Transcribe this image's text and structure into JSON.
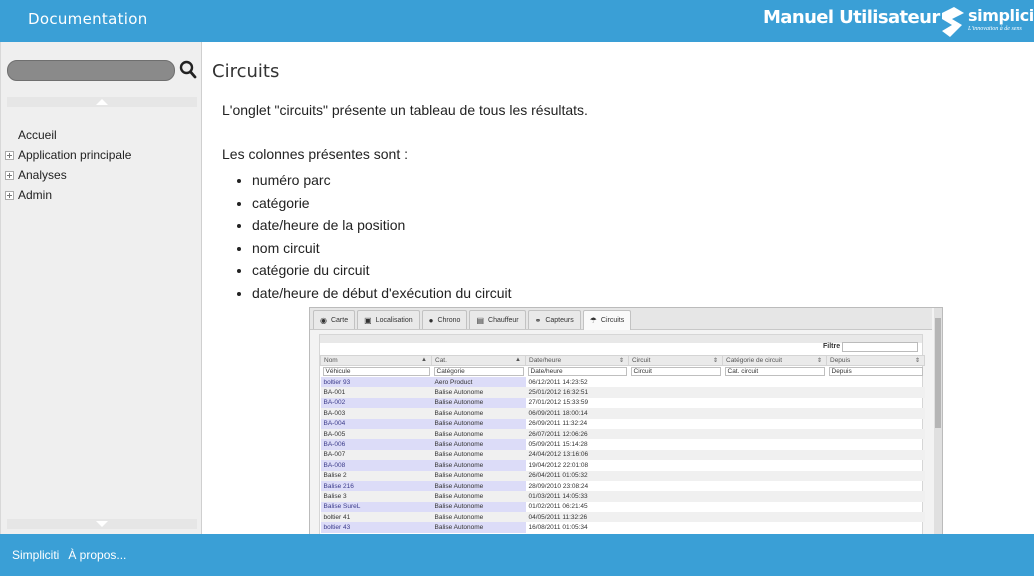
{
  "header": {
    "title": "Documentation",
    "manual_label": "Manuel Utilisateur",
    "brand_name": "simpliciti",
    "brand_tagline": "L'innovation à de sens"
  },
  "sidebar": {
    "search_placeholder": "",
    "items": [
      {
        "label": "Accueil",
        "expandable": false
      },
      {
        "label": "Application principale",
        "expandable": true
      },
      {
        "label": "Analyses",
        "expandable": true
      },
      {
        "label": "Admin",
        "expandable": true
      }
    ]
  },
  "main": {
    "title": "Circuits",
    "intro": "L'onglet \"circuits\" présente un tableau de tous les résultats.",
    "columns_intro": "Les colonnes présentes sont :",
    "bullets": [
      "numéro parc",
      "catégorie",
      "date/heure de la position",
      "nom circuit",
      "catégorie du circuit",
      "date/heure de début d'exécution du circuit"
    ]
  },
  "screenshot": {
    "tabs": [
      {
        "label": "Carte",
        "icon": "globe-icon"
      },
      {
        "label": "Localisation",
        "icon": "vehicle-icon"
      },
      {
        "label": "Chrono",
        "icon": "clock-icon"
      },
      {
        "label": "Chauffeur",
        "icon": "id-card-icon"
      },
      {
        "label": "Capteurs",
        "icon": "sensor-icon"
      },
      {
        "label": "Circuits",
        "icon": "route-icon",
        "active": true
      }
    ],
    "filter_label": "Filtre",
    "columns": [
      "Nom",
      "Cat.",
      "Date/heure",
      "Circuit",
      "Catégorie de circuit",
      "Depuis"
    ],
    "filters": [
      "Véhicule",
      "Catégorie",
      "Date/heure",
      "Circuit",
      "Cat. circuit",
      "Depuis"
    ],
    "rows": [
      [
        "boltier 93",
        "Aero Product",
        "06/12/2011 14:23:52"
      ],
      [
        "BA-001",
        "Balise Autonome",
        "25/01/2012 16:32:51"
      ],
      [
        "BA-002",
        "Balise Autonome",
        "27/01/2012 15:33:59"
      ],
      [
        "BA-003",
        "Balise Autonome",
        "06/09/2011 18:00:14"
      ],
      [
        "BA-004",
        "Balise Autonome",
        "26/09/2011 11:32:24"
      ],
      [
        "BA-005",
        "Balise Autonome",
        "26/07/2011 12:06:26"
      ],
      [
        "BA-006",
        "Balise Autonome",
        "05/09/2011 15:14:28"
      ],
      [
        "BA-007",
        "Balise Autonome",
        "24/04/2012 13:16:06"
      ],
      [
        "BA-008",
        "Balise Autonome",
        "19/04/2012 22:01:08"
      ],
      [
        "Balise 2",
        "Balise Autonome",
        "26/04/2011 01:05:32"
      ],
      [
        "Balise 216",
        "Balise Autonome",
        "28/09/2010 23:08:24"
      ],
      [
        "Balise 3",
        "Balise Autonome",
        "01/03/2011 14:05:33"
      ],
      [
        "Balise SureL",
        "Balise Autonome",
        "01/02/2011 06:21:45"
      ],
      [
        "boltier 41",
        "Balise Autonome",
        "04/05/2011 11:32:26"
      ],
      [
        "boltier 43",
        "Balise Autonome",
        "16/08/2011 01:05:34"
      ]
    ]
  },
  "footer": {
    "links": [
      "Simpliciti",
      "À propos..."
    ]
  }
}
